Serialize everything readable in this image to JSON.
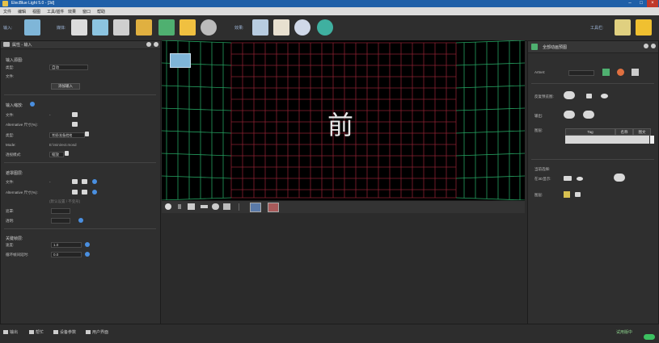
{
  "window": {
    "title": "ElecBlue Light 5.0 - [3d]",
    "controls": [
      "–",
      "□",
      "×"
    ]
  },
  "menu": [
    "文件",
    "编辑",
    "视图",
    "工具/插件",
    "效果",
    "窗口",
    "帮助"
  ],
  "toolbar": {
    "input_label": "输入:",
    "media_label": "媒体:",
    "effects_label": "效果:",
    "tools_label": "工具栏:"
  },
  "left_panel": {
    "header": "属性 - 输入",
    "sec_input_source": "输入源图:",
    "type_label": "类型:",
    "type_value": "自动",
    "file_label": "文件:",
    "add_button": "添加输入",
    "sec_input_scale": "输入缩放:",
    "file2_label": "文件:",
    "alt_label": "Alternative 尺寸(%):",
    "type2_label": "类型:",
    "type2_value": "常规/准备就绪",
    "mode_label": "Mode:",
    "mode_value": "E:\\minirect.mosd",
    "blend_label": "透视模式:",
    "blend_value": "缩放",
    "sec_mask": "遮罩图层:",
    "file3_label": "文件:",
    "alt2_label": "Alternative 尺寸(%):",
    "hint_text": "(默认设置 / 不变形)",
    "alpha_label": "遮罩:",
    "opacity_label": "透明:",
    "sec_key": "关键帧层:",
    "speed_label": "速度:",
    "speed_value": "1.0",
    "loop_label": "循环帧间延时:",
    "loop_value": "0.0"
  },
  "viewport": {
    "face_label": "前"
  },
  "right_panel": {
    "header": "全部动画预图",
    "artnet_label": "Artnet:",
    "preview_label": "反复预览图:",
    "output_label": "输出:",
    "layer_label": "图层:",
    "table_headers": [
      "Tag",
      "名称",
      "图文"
    ],
    "current_label": "当前选择:",
    "visible_label": "在3D显示:",
    "layer2_label": "图层:"
  },
  "statusbar": {
    "items": [
      "输出",
      "帮忙",
      "设备参数",
      "用户界面"
    ],
    "right_text": "试用版中"
  },
  "colors": {
    "titlebar": "#1f5fa8",
    "grid_red": "#8a2030",
    "grid_green": "#25a060",
    "accent_blue": "#4a8fe0"
  }
}
